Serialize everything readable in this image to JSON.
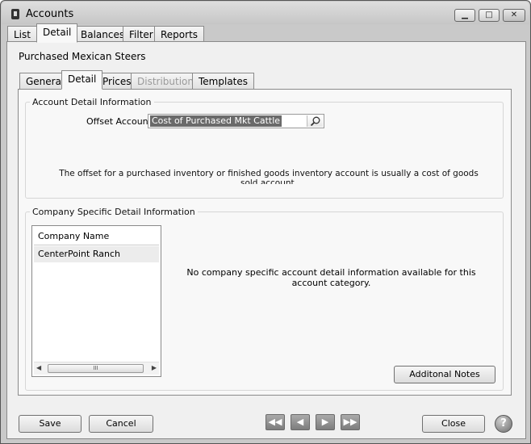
{
  "window": {
    "title": "Accounts",
    "minimize_glyph": "▁",
    "maximize_glyph": "□",
    "close_glyph": "✕"
  },
  "main_tabs": [
    {
      "label": "List",
      "active": false
    },
    {
      "label": "Detail",
      "active": true
    },
    {
      "label": "Balances",
      "active": false
    },
    {
      "label": "Filter",
      "active": false
    },
    {
      "label": "Reports",
      "active": false
    }
  ],
  "record": {
    "title": "Purchased Mexican Steers"
  },
  "sub_tabs": [
    {
      "label": "General",
      "active": false,
      "enabled": true
    },
    {
      "label": "Detail",
      "active": true,
      "enabled": true
    },
    {
      "label": "Prices",
      "active": false,
      "enabled": true
    },
    {
      "label": "Distributions",
      "active": false,
      "enabled": false
    },
    {
      "label": "Templates",
      "active": false,
      "enabled": true
    }
  ],
  "account_detail": {
    "legend": "Account Detail Information",
    "offset_label": "Offset Account",
    "offset_value": "Cost of Purchased Mkt Cattle",
    "info_text": "The offset for a purchased inventory or finished goods inventory account is usually a cost of goods sold account."
  },
  "company_detail": {
    "legend": "Company Specific Detail Information",
    "column_header": "Company Name",
    "rows": [
      "CenterPoint Ranch"
    ],
    "scroll_thumb_glyph": "III",
    "empty_message": "No company specific account detail information available for this account category.",
    "notes_button": "Additonal Notes"
  },
  "footer": {
    "save": "Save",
    "cancel": "Cancel",
    "close": "Close",
    "nav": {
      "first": "◀◀",
      "prev": "◀",
      "next": "▶",
      "last": "▶▶"
    },
    "help": "?"
  },
  "icons": {
    "lookup": "magnifier-icon",
    "help": "help-icon",
    "app": "accounts-app-icon"
  },
  "colors": {
    "selection": "#6a6a6a",
    "panel": "#f8f8f8",
    "frame": "#c9c9c9"
  }
}
